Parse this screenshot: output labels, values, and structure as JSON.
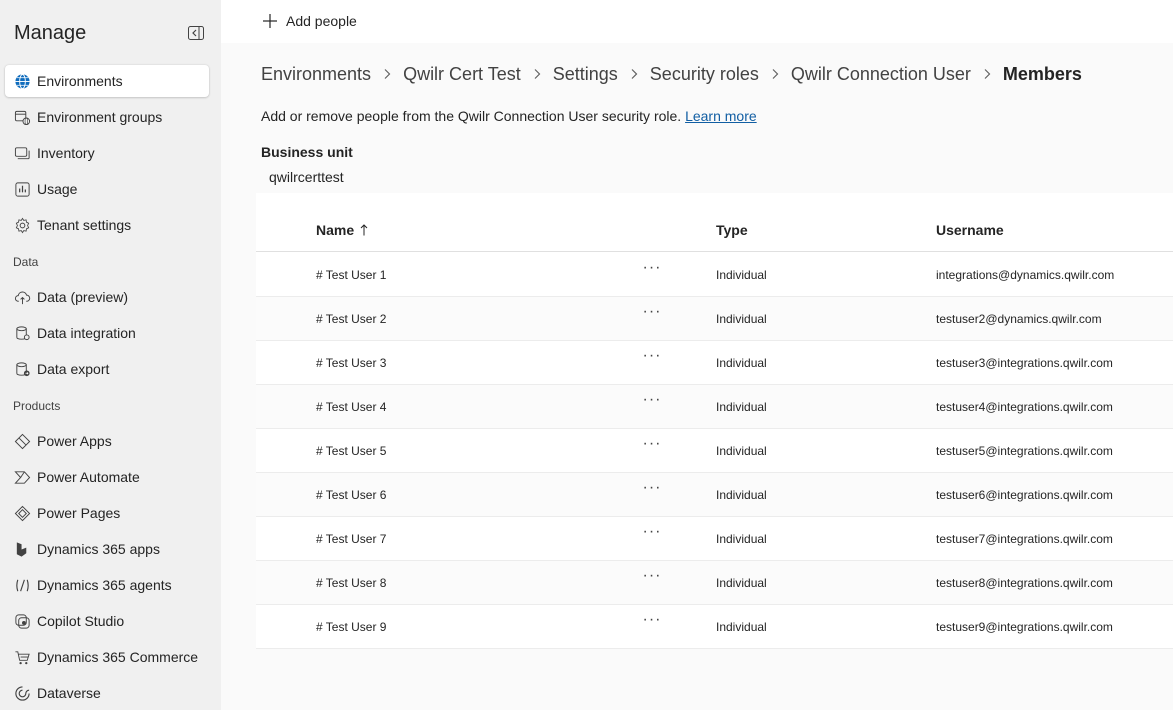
{
  "sidebar": {
    "title": "Manage",
    "items": [
      {
        "label": "Environments",
        "icon": "globe-icon",
        "active": true
      },
      {
        "label": "Environment groups",
        "icon": "environment-groups-icon"
      },
      {
        "label": "Inventory",
        "icon": "inventory-icon"
      },
      {
        "label": "Usage",
        "icon": "usage-chart-icon"
      },
      {
        "label": "Tenant settings",
        "icon": "gear-icon"
      }
    ],
    "sections": {
      "data": {
        "title": "Data",
        "items": [
          {
            "label": "Data (preview)",
            "icon": "cloud-upload-icon"
          },
          {
            "label": "Data integration",
            "icon": "database-icon"
          },
          {
            "label": "Data export",
            "icon": "database-export-icon"
          }
        ]
      },
      "products": {
        "title": "Products",
        "items": [
          {
            "label": "Power Apps",
            "icon": "power-apps-icon"
          },
          {
            "label": "Power Automate",
            "icon": "power-automate-icon"
          },
          {
            "label": "Power Pages",
            "icon": "power-pages-icon"
          },
          {
            "label": "Dynamics 365 apps",
            "icon": "dynamics-apps-icon"
          },
          {
            "label": "Dynamics 365 agents",
            "icon": "dynamics-agents-icon"
          },
          {
            "label": "Copilot Studio",
            "icon": "copilot-studio-icon"
          },
          {
            "label": "Dynamics 365 Commerce",
            "icon": "commerce-icon"
          },
          {
            "label": "Dataverse",
            "icon": "dataverse-icon"
          }
        ]
      }
    }
  },
  "toolbar": {
    "add_people_label": "Add people"
  },
  "breadcrumb": [
    "Environments",
    "Qwilr Cert Test",
    "Settings",
    "Security roles",
    "Qwilr Connection User",
    "Members"
  ],
  "description": {
    "text": "Add or remove people from the Qwilr Connection User security role.",
    "link": "Learn more"
  },
  "business_unit": {
    "label": "Business unit",
    "value": "qwilrcerttest"
  },
  "table": {
    "columns": {
      "name": "Name",
      "type": "Type",
      "username": "Username"
    },
    "more_label": "···",
    "rows": [
      {
        "name": "# Test User 1",
        "type": "Individual",
        "username": "integrations@dynamics.qwilr.com"
      },
      {
        "name": "# Test User 2",
        "type": "Individual",
        "username": "testuser2@dynamics.qwilr.com"
      },
      {
        "name": "# Test User 3",
        "type": "Individual",
        "username": "testuser3@integrations.qwilr.com"
      },
      {
        "name": "# Test User 4",
        "type": "Individual",
        "username": "testuser4@integrations.qwilr.com"
      },
      {
        "name": "# Test User 5",
        "type": "Individual",
        "username": "testuser5@integrations.qwilr.com"
      },
      {
        "name": "# Test User 6",
        "type": "Individual",
        "username": "testuser6@integrations.qwilr.com"
      },
      {
        "name": "# Test User 7",
        "type": "Individual",
        "username": "testuser7@integrations.qwilr.com"
      },
      {
        "name": "# Test User 8",
        "type": "Individual",
        "username": "testuser8@integrations.qwilr.com"
      },
      {
        "name": "# Test User 9",
        "type": "Individual",
        "username": "testuser9@integrations.qwilr.com"
      }
    ]
  },
  "colors": {
    "accent": "#0f6cbd",
    "link": "#115ea3",
    "sidebar_bg": "#f0f0f0"
  }
}
